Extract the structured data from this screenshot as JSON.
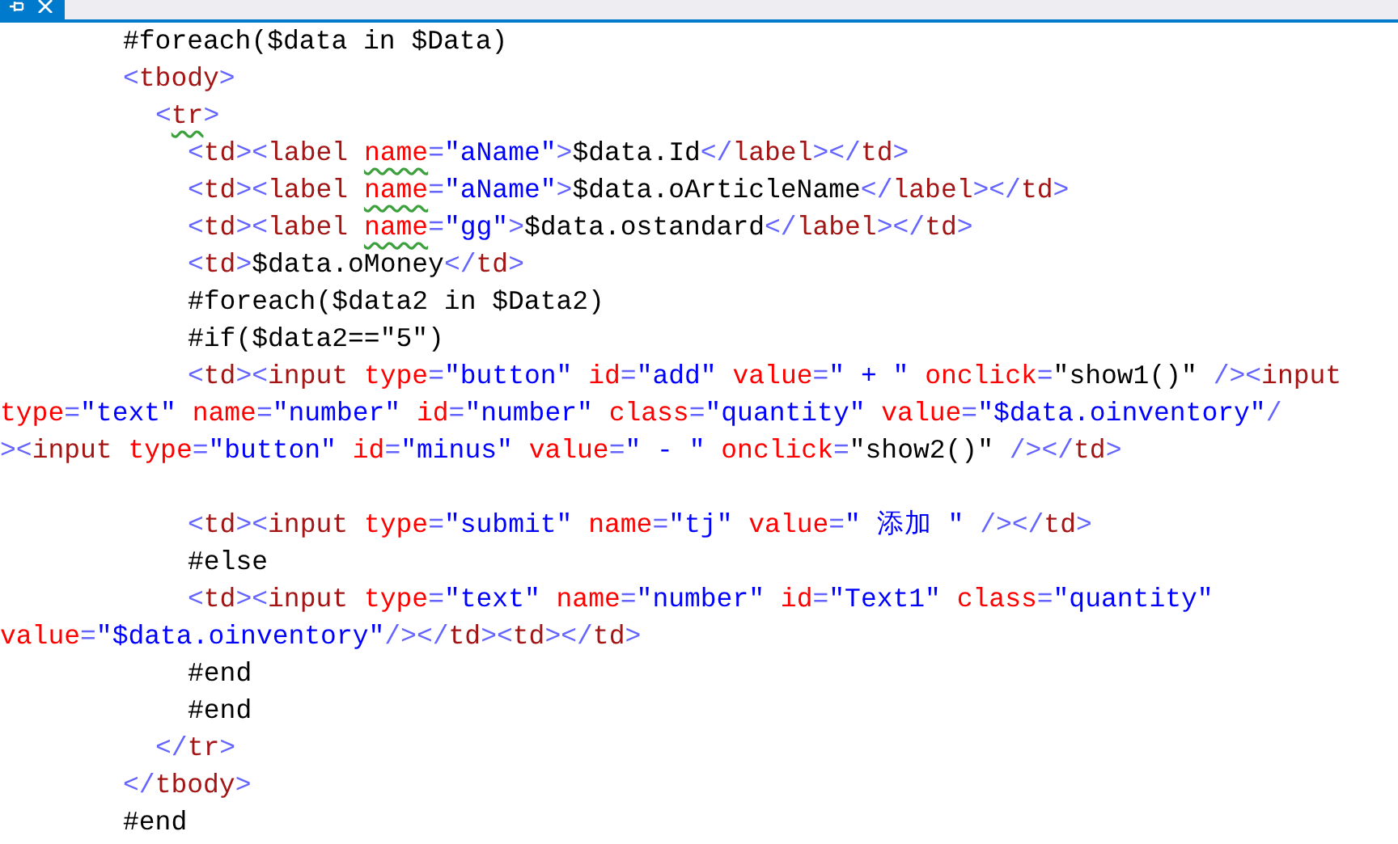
{
  "tab": {
    "pinned": true
  },
  "code": [
    {
      "kind": "line",
      "tokens": [
        {
          "kind": "text",
          "text": "#foreach($data in $Data)"
        }
      ]
    },
    {
      "kind": "line",
      "tokens": [
        {
          "kind": "bracket",
          "text": "<"
        },
        {
          "kind": "tag",
          "text": "tbody"
        },
        {
          "kind": "bracket",
          "text": ">"
        }
      ],
      "children": [
        {
          "kind": "line",
          "tokens": [
            {
              "kind": "bracket",
              "text": "<"
            },
            {
              "kind": "tag",
              "text": "tr",
              "warning": true
            },
            {
              "kind": "bracket",
              "text": ">"
            }
          ],
          "children": [
            {
              "kind": "line",
              "tokens": [
                {
                  "kind": "bracket",
                  "text": "<"
                },
                {
                  "kind": "tag",
                  "text": "td"
                },
                {
                  "kind": "bracket",
                  "text": "><"
                },
                {
                  "kind": "tag",
                  "text": "label "
                },
                {
                  "kind": "attr",
                  "text": "name",
                  "warning": true
                },
                {
                  "kind": "bracket",
                  "text": "="
                },
                {
                  "kind": "value",
                  "text": "\"aName\""
                },
                {
                  "kind": "bracket",
                  "text": ">"
                },
                {
                  "kind": "text",
                  "text": "$data.Id"
                },
                {
                  "kind": "bracket",
                  "text": "</"
                },
                {
                  "kind": "tag",
                  "text": "label"
                },
                {
                  "kind": "bracket",
                  "text": "></"
                },
                {
                  "kind": "tag",
                  "text": "td"
                },
                {
                  "kind": "bracket",
                  "text": ">"
                }
              ]
            },
            {
              "kind": "line",
              "tokens": [
                {
                  "kind": "bracket",
                  "text": "<"
                },
                {
                  "kind": "tag",
                  "text": "td"
                },
                {
                  "kind": "bracket",
                  "text": "><"
                },
                {
                  "kind": "tag",
                  "text": "label "
                },
                {
                  "kind": "attr",
                  "text": "name",
                  "warning": true
                },
                {
                  "kind": "bracket",
                  "text": "="
                },
                {
                  "kind": "value",
                  "text": "\"aName\""
                },
                {
                  "kind": "bracket",
                  "text": ">"
                },
                {
                  "kind": "text",
                  "text": "$data.oArticleName"
                },
                {
                  "kind": "bracket",
                  "text": "</"
                },
                {
                  "kind": "tag",
                  "text": "label"
                },
                {
                  "kind": "bracket",
                  "text": "></"
                },
                {
                  "kind": "tag",
                  "text": "td"
                },
                {
                  "kind": "bracket",
                  "text": ">"
                }
              ]
            },
            {
              "kind": "line",
              "tokens": [
                {
                  "kind": "bracket",
                  "text": "<"
                },
                {
                  "kind": "tag",
                  "text": "td"
                },
                {
                  "kind": "bracket",
                  "text": "><"
                },
                {
                  "kind": "tag",
                  "text": "label "
                },
                {
                  "kind": "attr",
                  "text": "name",
                  "warning": true
                },
                {
                  "kind": "bracket",
                  "text": "="
                },
                {
                  "kind": "value",
                  "text": "\"gg\""
                },
                {
                  "kind": "bracket",
                  "text": ">"
                },
                {
                  "kind": "text",
                  "text": "$data.ostandard"
                },
                {
                  "kind": "bracket",
                  "text": "</"
                },
                {
                  "kind": "tag",
                  "text": "label"
                },
                {
                  "kind": "bracket",
                  "text": "></"
                },
                {
                  "kind": "tag",
                  "text": "td"
                },
                {
                  "kind": "bracket",
                  "text": ">"
                }
              ]
            },
            {
              "kind": "line",
              "tokens": [
                {
                  "kind": "bracket",
                  "text": "<"
                },
                {
                  "kind": "tag",
                  "text": "td"
                },
                {
                  "kind": "bracket",
                  "text": ">"
                },
                {
                  "kind": "text",
                  "text": "$data.oMoney"
                },
                {
                  "kind": "bracket",
                  "text": "</"
                },
                {
                  "kind": "tag",
                  "text": "td"
                },
                {
                  "kind": "bracket",
                  "text": ">"
                }
              ]
            },
            {
              "kind": "line",
              "tokens": [
                {
                  "kind": "text",
                  "text": "#foreach($data2 in $Data2)"
                }
              ]
            },
            {
              "kind": "line",
              "tokens": [
                {
                  "kind": "text",
                  "text": "#if($data2==\"5\")"
                }
              ]
            },
            {
              "kind": "line",
              "tokens": [
                {
                  "kind": "bracket",
                  "text": "<"
                },
                {
                  "kind": "tag",
                  "text": "td"
                },
                {
                  "kind": "bracket",
                  "text": "><"
                },
                {
                  "kind": "tag",
                  "text": "input "
                },
                {
                  "kind": "attr",
                  "text": "type"
                },
                {
                  "kind": "bracket",
                  "text": "="
                },
                {
                  "kind": "value",
                  "text": "\"button\" "
                },
                {
                  "kind": "attr",
                  "text": "id"
                },
                {
                  "kind": "bracket",
                  "text": "="
                },
                {
                  "kind": "value",
                  "text": "\"add\" "
                },
                {
                  "kind": "attr",
                  "text": "value"
                },
                {
                  "kind": "bracket",
                  "text": "="
                },
                {
                  "kind": "value",
                  "text": "\" + \" "
                },
                {
                  "kind": "attr",
                  "text": "onclick"
                },
                {
                  "kind": "bracket",
                  "text": "="
                },
                {
                  "kind": "text",
                  "text": "\"show1()\" "
                },
                {
                  "kind": "bracket",
                  "text": "/><"
                },
                {
                  "kind": "tag",
                  "text": "input"
                }
              ]
            },
            {
              "kind": "wrap",
              "tokens": [
                {
                  "kind": "attr",
                  "text": "type"
                },
                {
                  "kind": "bracket",
                  "text": "="
                },
                {
                  "kind": "value",
                  "text": "\"text\" "
                },
                {
                  "kind": "attr",
                  "text": "name"
                },
                {
                  "kind": "bracket",
                  "text": "="
                },
                {
                  "kind": "value",
                  "text": "\"number\" "
                },
                {
                  "kind": "attr",
                  "text": "id"
                },
                {
                  "kind": "bracket",
                  "text": "="
                },
                {
                  "kind": "value",
                  "text": "\"number\" "
                },
                {
                  "kind": "attr",
                  "text": "class"
                },
                {
                  "kind": "bracket",
                  "text": "="
                },
                {
                  "kind": "value",
                  "text": "\"quantity\" "
                },
                {
                  "kind": "attr",
                  "text": "value"
                },
                {
                  "kind": "bracket",
                  "text": "="
                },
                {
                  "kind": "value",
                  "text": "\"$data.oinventory\""
                },
                {
                  "kind": "bracket",
                  "text": "/"
                }
              ]
            },
            {
              "kind": "wrap",
              "tokens": [
                {
                  "kind": "bracket",
                  "text": "><"
                },
                {
                  "kind": "tag",
                  "text": "input "
                },
                {
                  "kind": "attr",
                  "text": "type"
                },
                {
                  "kind": "bracket",
                  "text": "="
                },
                {
                  "kind": "value",
                  "text": "\"button\" "
                },
                {
                  "kind": "attr",
                  "text": "id"
                },
                {
                  "kind": "bracket",
                  "text": "="
                },
                {
                  "kind": "value",
                  "text": "\"minus\" "
                },
                {
                  "kind": "attr",
                  "text": "value"
                },
                {
                  "kind": "bracket",
                  "text": "="
                },
                {
                  "kind": "value",
                  "text": "\" - \" "
                },
                {
                  "kind": "attr",
                  "text": "onclick"
                },
                {
                  "kind": "bracket",
                  "text": "="
                },
                {
                  "kind": "text",
                  "text": "\"show2()\" "
                },
                {
                  "kind": "bracket",
                  "text": "/></"
                },
                {
                  "kind": "tag",
                  "text": "td"
                },
                {
                  "kind": "bracket",
                  "text": ">"
                }
              ]
            },
            {
              "kind": "blank"
            },
            {
              "kind": "line",
              "tokens": [
                {
                  "kind": "bracket",
                  "text": "<"
                },
                {
                  "kind": "tag",
                  "text": "td"
                },
                {
                  "kind": "bracket",
                  "text": "><"
                },
                {
                  "kind": "tag",
                  "text": "input "
                },
                {
                  "kind": "attr",
                  "text": "type"
                },
                {
                  "kind": "bracket",
                  "text": "="
                },
                {
                  "kind": "value",
                  "text": "\"submit\" "
                },
                {
                  "kind": "attr",
                  "text": "name"
                },
                {
                  "kind": "bracket",
                  "text": "="
                },
                {
                  "kind": "value",
                  "text": "\"tj\" "
                },
                {
                  "kind": "attr",
                  "text": "value"
                },
                {
                  "kind": "bracket",
                  "text": "="
                },
                {
                  "kind": "value",
                  "text": "\" 添加 \" "
                },
                {
                  "kind": "bracket",
                  "text": "/></"
                },
                {
                  "kind": "tag",
                  "text": "td"
                },
                {
                  "kind": "bracket",
                  "text": ">"
                }
              ]
            },
            {
              "kind": "line",
              "tokens": [
                {
                  "kind": "text",
                  "text": "#else"
                }
              ]
            },
            {
              "kind": "line",
              "tokens": [
                {
                  "kind": "bracket",
                  "text": "<"
                },
                {
                  "kind": "tag",
                  "text": "td"
                },
                {
                  "kind": "bracket",
                  "text": "><"
                },
                {
                  "kind": "tag",
                  "text": "input "
                },
                {
                  "kind": "attr",
                  "text": "type"
                },
                {
                  "kind": "bracket",
                  "text": "="
                },
                {
                  "kind": "value",
                  "text": "\"text\" "
                },
                {
                  "kind": "attr",
                  "text": "name"
                },
                {
                  "kind": "bracket",
                  "text": "="
                },
                {
                  "kind": "value",
                  "text": "\"number\" "
                },
                {
                  "kind": "attr",
                  "text": "id"
                },
                {
                  "kind": "bracket",
                  "text": "="
                },
                {
                  "kind": "value",
                  "text": "\"Text1\" "
                },
                {
                  "kind": "attr",
                  "text": "class"
                },
                {
                  "kind": "bracket",
                  "text": "="
                },
                {
                  "kind": "value",
                  "text": "\"quantity\""
                }
              ]
            },
            {
              "kind": "wrap",
              "tokens": [
                {
                  "kind": "attr",
                  "text": "value"
                },
                {
                  "kind": "bracket",
                  "text": "="
                },
                {
                  "kind": "value",
                  "text": "\"$data.oinventory\""
                },
                {
                  "kind": "bracket",
                  "text": "/></"
                },
                {
                  "kind": "tag",
                  "text": "td"
                },
                {
                  "kind": "bracket",
                  "text": "><"
                },
                {
                  "kind": "tag",
                  "text": "td"
                },
                {
                  "kind": "bracket",
                  "text": "></"
                },
                {
                  "kind": "tag",
                  "text": "td"
                },
                {
                  "kind": "bracket",
                  "text": ">"
                }
              ]
            },
            {
              "kind": "line",
              "tokens": [
                {
                  "kind": "text",
                  "text": "#end"
                }
              ]
            },
            {
              "kind": "line",
              "tokens": [
                {
                  "kind": "text",
                  "text": "#end"
                }
              ]
            }
          ]
        },
        {
          "kind": "line",
          "tokens": [
            {
              "kind": "bracket",
              "text": "</"
            },
            {
              "kind": "tag",
              "text": "tr"
            },
            {
              "kind": "bracket",
              "text": ">"
            }
          ]
        }
      ]
    },
    {
      "kind": "line",
      "tokens": [
        {
          "kind": "bracket",
          "text": "</"
        },
        {
          "kind": "tag",
          "text": "tbody"
        },
        {
          "kind": "bracket",
          "text": ">"
        }
      ]
    },
    {
      "kind": "line",
      "tokens": [
        {
          "kind": "text",
          "text": "#end"
        }
      ]
    }
  ]
}
